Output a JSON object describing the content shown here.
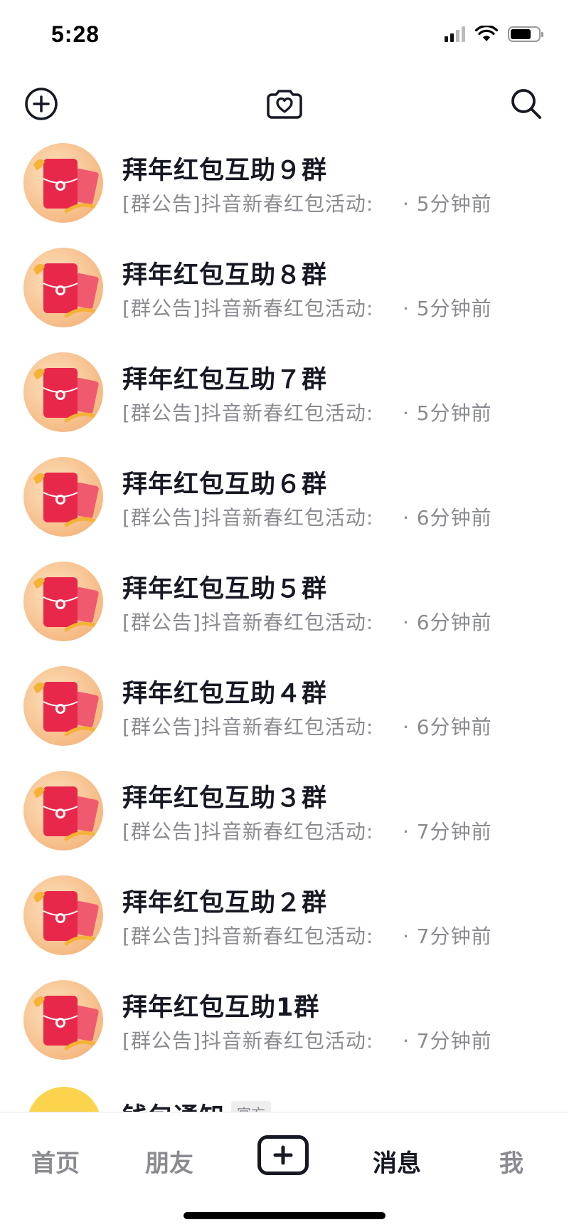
{
  "status_bar": {
    "time": "5:28",
    "icons": [
      "signal-icon",
      "wifi-icon",
      "battery-icon"
    ]
  },
  "top_nav": {
    "icons": [
      "add-circle-icon",
      "heart-camera-icon",
      "search-icon"
    ]
  },
  "chats": [
    {
      "title": "拜年红包互助９群",
      "preview": "[群公告]抖音新春红包活动:",
      "time": "· 5分钟前"
    },
    {
      "title": "拜年红包互助８群",
      "preview": "[群公告]抖音新春红包活动:",
      "time": "· 5分钟前"
    },
    {
      "title": "拜年红包互助７群",
      "preview": "[群公告]抖音新春红包活动:",
      "time": "· 5分钟前"
    },
    {
      "title": "拜年红包互助６群",
      "preview": "[群公告]抖音新春红包活动:",
      "time": "· 6分钟前"
    },
    {
      "title": "拜年红包互助５群",
      "preview": "[群公告]抖音新春红包活动:",
      "time": "· 6分钟前"
    },
    {
      "title": "拜年红包互助４群",
      "preview": "[群公告]抖音新春红包活动:",
      "time": "· 6分钟前"
    },
    {
      "title": "拜年红包互助３群",
      "preview": "[群公告]抖音新春红包活动:",
      "time": "· 7分钟前"
    },
    {
      "title": "拜年红包互助２群",
      "preview": "[群公告]抖音新春红包活动:",
      "time": "· 7分钟前"
    },
    {
      "title": "拜年红包互助1群",
      "preview": "[群公告]抖音新春红包活动:",
      "time": "· 7分钟前"
    }
  ],
  "partial_chat": {
    "title": "钱包通知",
    "badge": "官方"
  },
  "tab_bar": {
    "home": "首页",
    "friends": "朋友",
    "create_icon": "plus-icon",
    "messages": "消息",
    "me": "我",
    "active": "messages"
  },
  "colors": {
    "primary_text": "#161823",
    "secondary_text": "#8a8b91",
    "red_packet": "#e8284b",
    "avatar_bg": "#f7c391"
  }
}
